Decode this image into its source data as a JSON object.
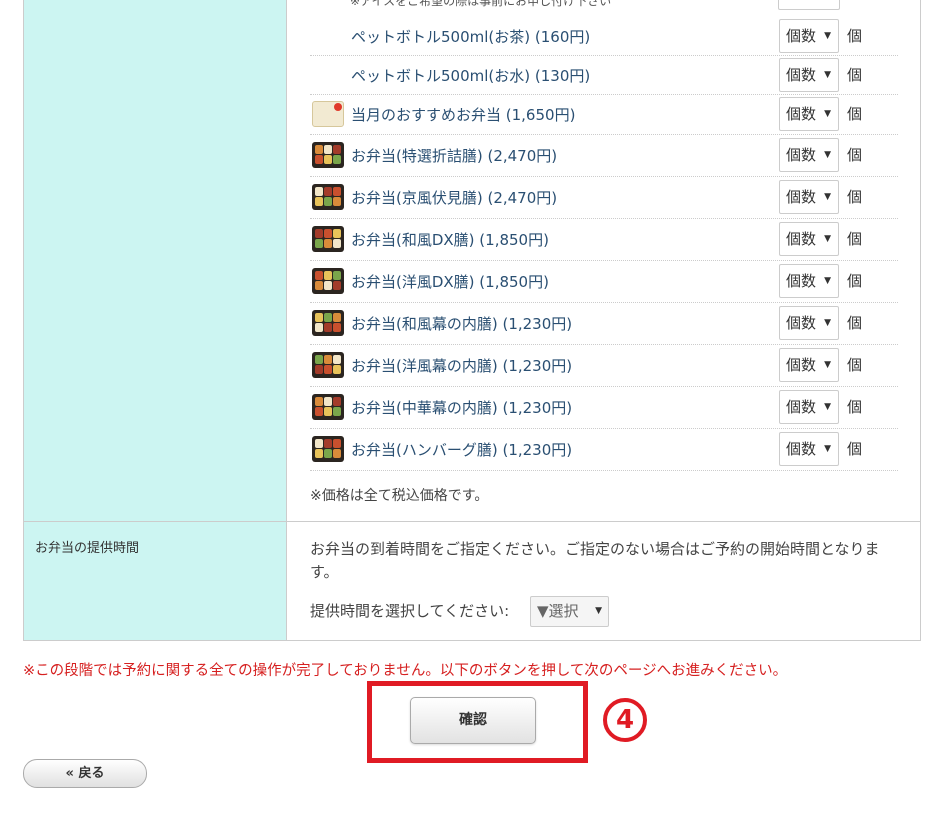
{
  "menu": {
    "top_note": "※アイスをご希望の際は事前にお申し付け下さい",
    "quantity_placeholder": "個数",
    "unit": "個",
    "items": [
      {
        "name": "ペットボトル500ml(お茶)",
        "price": "(160円)",
        "thumb": "none"
      },
      {
        "name": "ペットボトル500ml(お水)",
        "price": "(130円)",
        "thumb": "none"
      },
      {
        "name": "当月のおすすめお弁当",
        "price": "(1,650円)",
        "thumb": "recommend-icon"
      },
      {
        "name": "お弁当(特選折詰膳)",
        "price": "(2,470円)",
        "thumb": "bento-icon"
      },
      {
        "name": "お弁当(京風伏見膳)",
        "price": "(2,470円)",
        "thumb": "bento-icon"
      },
      {
        "name": "お弁当(和風DX膳)",
        "price": "(1,850円)",
        "thumb": "bento-icon"
      },
      {
        "name": "お弁当(洋風DX膳)",
        "price": "(1,850円)",
        "thumb": "bento-icon"
      },
      {
        "name": "お弁当(和風幕の内膳)",
        "price": "(1,230円)",
        "thumb": "bento-icon"
      },
      {
        "name": "お弁当(洋風幕の内膳)",
        "price": "(1,230円)",
        "thumb": "bento-icon"
      },
      {
        "name": "お弁当(中華幕の内膳)",
        "price": "(1,230円)",
        "thumb": "bento-icon"
      },
      {
        "name": "お弁当(ハンバーグ膳)",
        "price": "(1,230円)",
        "thumb": "bento-icon"
      }
    ],
    "price_note": "※価格は全て税込価格です。"
  },
  "delivery_time": {
    "label": "お弁当の提供時間",
    "description": "お弁当の到着時間をご指定ください。ご指定のない場合はご予約の開始時間となります。",
    "prompt": "提供時間を選択してください:",
    "select_value": "▼選択"
  },
  "warning": "※この段階では予約に関する全ての操作が完了しておりません。以下のボタンを押して次のページへお進みください。",
  "confirm_label": "確認",
  "step_marker": "4",
  "back_label": "« 戻る",
  "colors": {
    "label_bg": "#ccf5f2",
    "link": "#2a4f72",
    "warning": "#d62020",
    "highlight": "#e01b24"
  }
}
